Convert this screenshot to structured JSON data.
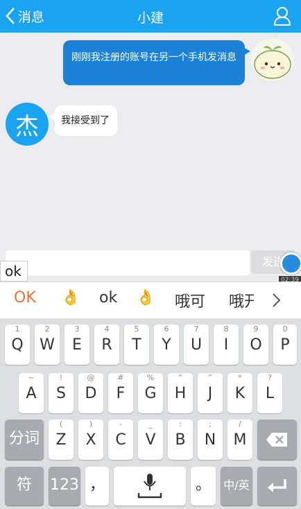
{
  "header": {
    "back_label": "消息",
    "title": "小建"
  },
  "messages": [
    {
      "sender": "me",
      "text": "刚刚我注册的账号在另一个手机发消息"
    },
    {
      "sender": "other",
      "avatar_char": "杰",
      "text": "我接受到了"
    }
  ],
  "input": {
    "value": "",
    "send_label": "发送"
  },
  "overlay": {
    "time": "02:39",
    "typed_preview": "ok"
  },
  "candidates": [
    "OK",
    "👌",
    "ok",
    "👌",
    "哦可",
    "哦开"
  ],
  "keyboard": {
    "row1": [
      {
        "main": "Q",
        "sub": "1"
      },
      {
        "main": "W",
        "sub": "2"
      },
      {
        "main": "E",
        "sub": "3"
      },
      {
        "main": "R",
        "sub": "4"
      },
      {
        "main": "T",
        "sub": "5"
      },
      {
        "main": "Y",
        "sub": "6"
      },
      {
        "main": "U",
        "sub": "7"
      },
      {
        "main": "I",
        "sub": "8"
      },
      {
        "main": "O",
        "sub": "9"
      },
      {
        "main": "P",
        "sub": "0"
      }
    ],
    "row2": [
      {
        "main": "A",
        "sub": "~"
      },
      {
        "main": "S",
        "sub": "!"
      },
      {
        "main": "D",
        "sub": "@"
      },
      {
        "main": "F",
        "sub": "#"
      },
      {
        "main": "G",
        "sub": "%"
      },
      {
        "main": "H",
        "sub": "“"
      },
      {
        "main": "J",
        "sub": "”"
      },
      {
        "main": "K",
        "sub": "*"
      },
      {
        "main": "L",
        "sub": "?"
      }
    ],
    "row3": [
      {
        "main": "Z",
        "sub": "("
      },
      {
        "main": "X",
        "sub": ")"
      },
      {
        "main": "C",
        "sub": "-"
      },
      {
        "main": "V",
        "sub": "_"
      },
      {
        "main": "B",
        "sub": ":"
      },
      {
        "main": "N",
        "sub": ";"
      },
      {
        "main": "M",
        "sub": "/"
      }
    ],
    "fenci": "分词",
    "symbol": "符",
    "num": "123",
    "comma": "，",
    "period": "。",
    "lang": "中/英"
  }
}
